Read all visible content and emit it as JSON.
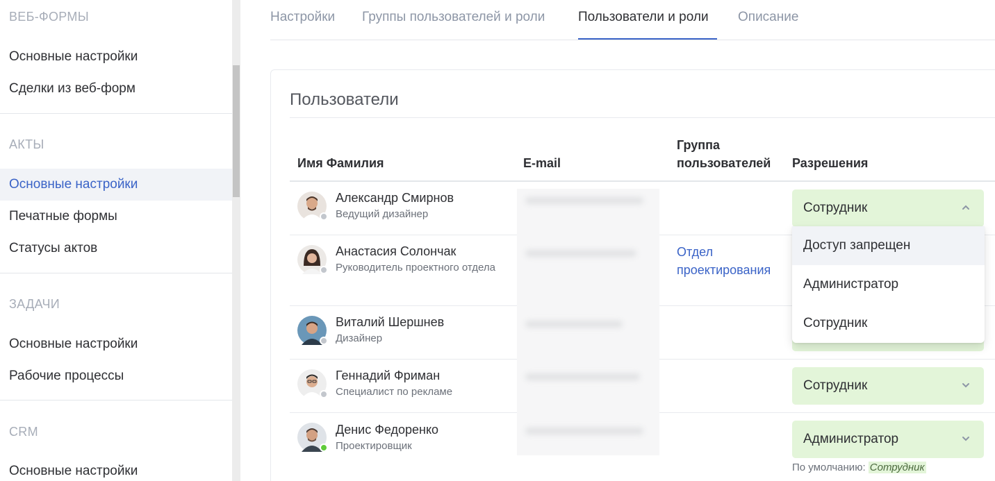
{
  "sidebar": {
    "sections": [
      {
        "title": "ВЕБ-ФОРМЫ",
        "items": [
          "Основные настройки",
          "Сделки из веб-форм"
        ]
      },
      {
        "title": "АКТЫ",
        "items": [
          "Основные настройки",
          "Печатные формы",
          "Статусы актов"
        ]
      },
      {
        "title": "ЗАДАЧИ",
        "items": [
          "Основные настройки",
          "Рабочие процессы"
        ]
      },
      {
        "title": "CRM",
        "items": [
          "Основные настройки"
        ]
      }
    ],
    "active_item": "АКТЫ / Основные настройки"
  },
  "tabs": [
    "Настройки",
    "Группы пользователей и роли",
    "Пользователи и роли",
    "Описание"
  ],
  "active_tab": "Пользователи и роли",
  "card": {
    "title": "Пользователи",
    "columns": {
      "name": "Имя Фамилия",
      "email": "E-mail",
      "group_line1": "Группа",
      "group_line2": "пользователей",
      "permissions": "Разрешения"
    }
  },
  "users": [
    {
      "name": "Александр Смирнов",
      "role": "Ведущий дизайнер",
      "group": "",
      "permission": "Сотрудник",
      "status": "offline"
    },
    {
      "name": "Анастасия Солончак",
      "role": "Руководитель проектного отдела",
      "group_line1": "Отдел",
      "group_line2": "проектирования",
      "permission": "",
      "status": "offline"
    },
    {
      "name": "Виталий Шершнев",
      "role": "Дизайнер",
      "group": "",
      "permission": "",
      "status": "offline"
    },
    {
      "name": "Геннадий Фриман",
      "role": "Специалист по рекламе",
      "group": "",
      "permission": "Сотрудник",
      "status": "offline"
    },
    {
      "name": "Денис Федоренко",
      "role": "Проектировщик",
      "group": "",
      "permission": "Администратор",
      "status": "online"
    }
  ],
  "dropdown": {
    "options": [
      "Доступ запрещен",
      "Администратор",
      "Сотрудник"
    ],
    "highlighted": "Доступ запрещен"
  },
  "default_hint": {
    "label": "По умолчанию:",
    "value": "Сотрудник"
  },
  "colors": {
    "accent": "#3a63c7",
    "permission_bg": "#e3f5d9",
    "online": "#5fcb3a",
    "offline": "#c3c7cd"
  }
}
